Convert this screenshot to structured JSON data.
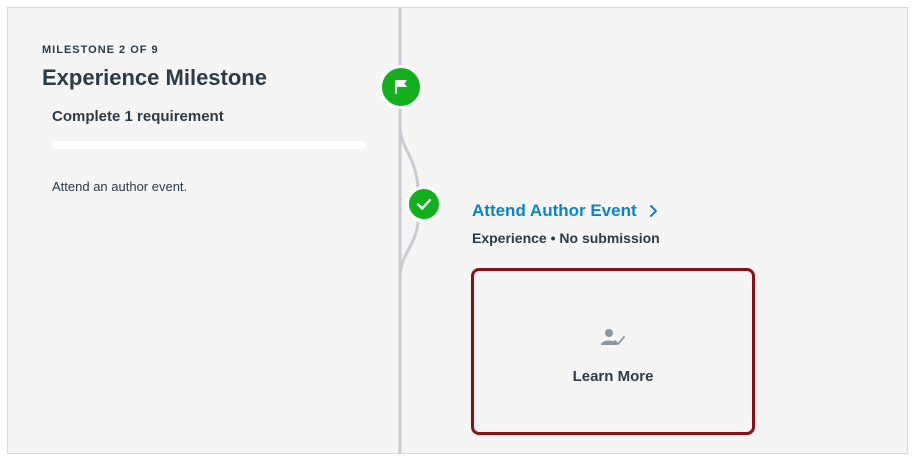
{
  "milestone": {
    "eyebrow": "MILESTONE 2 OF 9",
    "title": "Experience Milestone",
    "requirement_summary": "Complete 1 requirement",
    "progress_fraction": 0,
    "description": "Attend an author event."
  },
  "requirement": {
    "title": "Attend Author Event",
    "meta": "Experience • No submission"
  },
  "learn_more": {
    "label": "Learn More"
  },
  "icons": {
    "milestone_node": "flag-icon",
    "requirement_node": "checkmark-icon",
    "requirement_link": "chevron-right-icon",
    "learn_more": "person-check-icon"
  },
  "colors": {
    "success_green": "#12b01d",
    "link_blue": "#0a84c9",
    "highlight_border": "#8b0f13",
    "text_dark": "#2d3b45"
  }
}
